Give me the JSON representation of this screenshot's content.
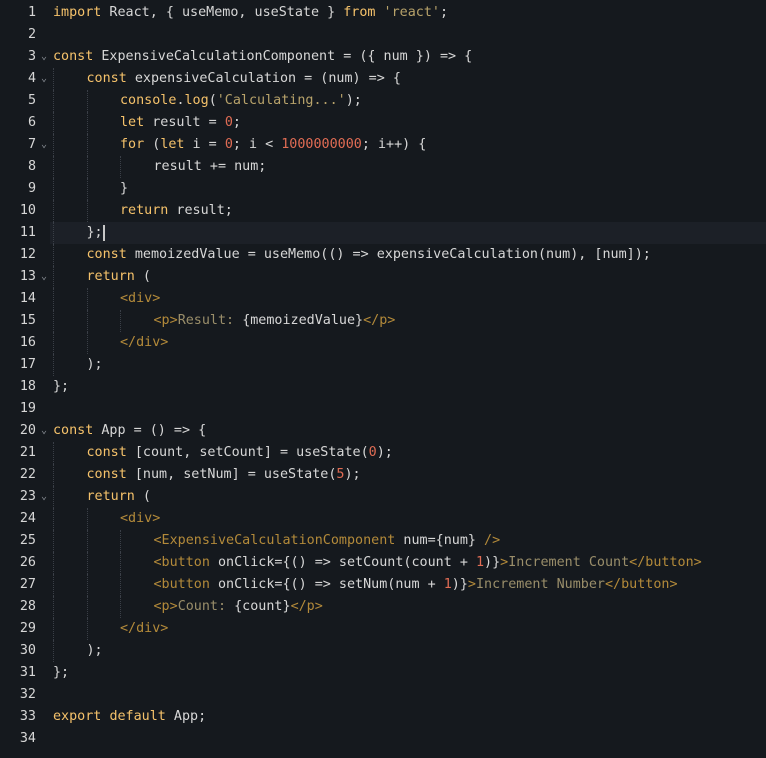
{
  "editor": {
    "language": "javascript-jsx",
    "active_line": 11,
    "colors": {
      "background": "#15191e",
      "keyword": "#f5c26b",
      "string": "#b7a26a",
      "number": "#e06c54",
      "tag": "#b38a3a",
      "text": "#d7d7d7"
    },
    "lines": [
      {
        "n": "1",
        "fold": false,
        "indent": 0,
        "tokens": [
          [
            "kw",
            "import"
          ],
          [
            "op",
            " React, { useMemo, useState } "
          ],
          [
            "kw",
            "from"
          ],
          [
            "op",
            " "
          ],
          [
            "st",
            "'react'"
          ],
          [
            "op",
            ";"
          ]
        ]
      },
      {
        "n": "2",
        "fold": false,
        "indent": 0,
        "tokens": []
      },
      {
        "n": "3",
        "fold": true,
        "indent": 0,
        "tokens": [
          [
            "kw",
            "const"
          ],
          [
            "op",
            " ExpensiveCalculationComponent = ({ num }) => {"
          ]
        ]
      },
      {
        "n": "4",
        "fold": true,
        "indent": 1,
        "tokens": [
          [
            "kw",
            "const"
          ],
          [
            "op",
            " expensiveCalculation = (num) => {"
          ]
        ]
      },
      {
        "n": "5",
        "fold": false,
        "indent": 2,
        "tokens": [
          [
            "kw",
            "console"
          ],
          [
            "op",
            "."
          ],
          [
            "kw",
            "log"
          ],
          [
            "op",
            "("
          ],
          [
            "st",
            "'Calculating...'"
          ],
          [
            "op",
            ");"
          ]
        ]
      },
      {
        "n": "6",
        "fold": false,
        "indent": 2,
        "tokens": [
          [
            "kw",
            "let"
          ],
          [
            "op",
            " result = "
          ],
          [
            "nm",
            "0"
          ],
          [
            "op",
            ";"
          ]
        ]
      },
      {
        "n": "7",
        "fold": true,
        "indent": 2,
        "tokens": [
          [
            "kw",
            "for"
          ],
          [
            "op",
            " ("
          ],
          [
            "kw",
            "let"
          ],
          [
            "op",
            " i = "
          ],
          [
            "nm",
            "0"
          ],
          [
            "op",
            "; i < "
          ],
          [
            "nm",
            "1000000000"
          ],
          [
            "op",
            "; i++) {"
          ]
        ]
      },
      {
        "n": "8",
        "fold": false,
        "indent": 3,
        "tokens": [
          [
            "op",
            "result += num;"
          ]
        ]
      },
      {
        "n": "9",
        "fold": false,
        "indent": 2,
        "tokens": [
          [
            "op",
            "}"
          ]
        ]
      },
      {
        "n": "10",
        "fold": false,
        "indent": 2,
        "tokens": [
          [
            "kw",
            "return"
          ],
          [
            "op",
            " result;"
          ]
        ]
      },
      {
        "n": "11",
        "fold": false,
        "indent": 1,
        "tokens": [
          [
            "op",
            "};"
          ]
        ]
      },
      {
        "n": "12",
        "fold": false,
        "indent": 1,
        "tokens": [
          [
            "kw",
            "const"
          ],
          [
            "op",
            " memoizedValue = useMemo(() => expensiveCalculation(num), [num]);"
          ]
        ]
      },
      {
        "n": "13",
        "fold": true,
        "indent": 1,
        "tokens": [
          [
            "kw",
            "return"
          ],
          [
            "op",
            " ("
          ]
        ]
      },
      {
        "n": "14",
        "fold": false,
        "indent": 2,
        "tokens": [
          [
            "tag",
            "<div>"
          ]
        ]
      },
      {
        "n": "15",
        "fold": false,
        "indent": 3,
        "tokens": [
          [
            "tag",
            "<p>"
          ],
          [
            "txt",
            "Result: "
          ],
          [
            "op",
            "{memoizedValue}"
          ],
          [
            "tag",
            "</p>"
          ]
        ]
      },
      {
        "n": "16",
        "fold": false,
        "indent": 2,
        "tokens": [
          [
            "tag",
            "</div>"
          ]
        ]
      },
      {
        "n": "17",
        "fold": false,
        "indent": 1,
        "tokens": [
          [
            "op",
            ");"
          ]
        ]
      },
      {
        "n": "18",
        "fold": false,
        "indent": 0,
        "tokens": [
          [
            "op",
            "};"
          ]
        ]
      },
      {
        "n": "19",
        "fold": false,
        "indent": 0,
        "tokens": []
      },
      {
        "n": "20",
        "fold": true,
        "indent": 0,
        "tokens": [
          [
            "kw",
            "const"
          ],
          [
            "op",
            " App = () => {"
          ]
        ]
      },
      {
        "n": "21",
        "fold": false,
        "indent": 1,
        "tokens": [
          [
            "kw",
            "const"
          ],
          [
            "op",
            " [count, setCount] = useState("
          ],
          [
            "nm",
            "0"
          ],
          [
            "op",
            ");"
          ]
        ]
      },
      {
        "n": "22",
        "fold": false,
        "indent": 1,
        "tokens": [
          [
            "kw",
            "const"
          ],
          [
            "op",
            " [num, setNum] = useState("
          ],
          [
            "nm",
            "5"
          ],
          [
            "op",
            ");"
          ]
        ]
      },
      {
        "n": "23",
        "fold": true,
        "indent": 1,
        "tokens": [
          [
            "kw",
            "return"
          ],
          [
            "op",
            " ("
          ]
        ]
      },
      {
        "n": "24",
        "fold": false,
        "indent": 2,
        "tokens": [
          [
            "tag",
            "<div>"
          ]
        ]
      },
      {
        "n": "25",
        "fold": false,
        "indent": 3,
        "tokens": [
          [
            "tag",
            "<ExpensiveCalculationComponent"
          ],
          [
            "op",
            " num={num} "
          ],
          [
            "tag",
            "/>"
          ]
        ]
      },
      {
        "n": "26",
        "fold": false,
        "indent": 3,
        "tokens": [
          [
            "tag",
            "<button"
          ],
          [
            "op",
            " onClick={() => setCount(count + "
          ],
          [
            "nm",
            "1"
          ],
          [
            "op",
            ")}"
          ],
          [
            "tag",
            ">"
          ],
          [
            "txt",
            "Increment Count"
          ],
          [
            "tag",
            "</button>"
          ]
        ]
      },
      {
        "n": "27",
        "fold": false,
        "indent": 3,
        "tokens": [
          [
            "tag",
            "<button"
          ],
          [
            "op",
            " onClick={() => setNum(num + "
          ],
          [
            "nm",
            "1"
          ],
          [
            "op",
            ")}"
          ],
          [
            "tag",
            ">"
          ],
          [
            "txt",
            "Increment Number"
          ],
          [
            "tag",
            "</button>"
          ]
        ]
      },
      {
        "n": "28",
        "fold": false,
        "indent": 3,
        "tokens": [
          [
            "tag",
            "<p>"
          ],
          [
            "txt",
            "Count: "
          ],
          [
            "op",
            "{count}"
          ],
          [
            "tag",
            "</p>"
          ]
        ]
      },
      {
        "n": "29",
        "fold": false,
        "indent": 2,
        "tokens": [
          [
            "tag",
            "</div>"
          ]
        ]
      },
      {
        "n": "30",
        "fold": false,
        "indent": 1,
        "tokens": [
          [
            "op",
            ");"
          ]
        ]
      },
      {
        "n": "31",
        "fold": false,
        "indent": 0,
        "tokens": [
          [
            "op",
            "};"
          ]
        ]
      },
      {
        "n": "32",
        "fold": false,
        "indent": 0,
        "tokens": []
      },
      {
        "n": "33",
        "fold": false,
        "indent": 0,
        "tokens": [
          [
            "kw",
            "export"
          ],
          [
            "op",
            " "
          ],
          [
            "kw",
            "default"
          ],
          [
            "op",
            " App;"
          ]
        ]
      },
      {
        "n": "34",
        "fold": false,
        "indent": 0,
        "tokens": []
      }
    ]
  }
}
